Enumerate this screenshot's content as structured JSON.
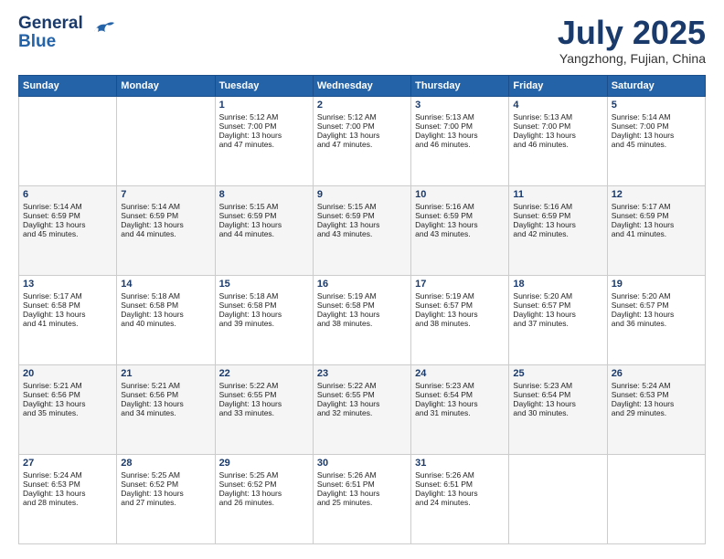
{
  "header": {
    "logo_line1": "General",
    "logo_line2": "Blue",
    "month": "July 2025",
    "location": "Yangzhong, Fujian, China"
  },
  "days_of_week": [
    "Sunday",
    "Monday",
    "Tuesday",
    "Wednesday",
    "Thursday",
    "Friday",
    "Saturday"
  ],
  "weeks": [
    [
      {
        "day": "",
        "info": ""
      },
      {
        "day": "",
        "info": ""
      },
      {
        "day": "1",
        "info": "Sunrise: 5:12 AM\nSunset: 7:00 PM\nDaylight: 13 hours\nand 47 minutes."
      },
      {
        "day": "2",
        "info": "Sunrise: 5:12 AM\nSunset: 7:00 PM\nDaylight: 13 hours\nand 47 minutes."
      },
      {
        "day": "3",
        "info": "Sunrise: 5:13 AM\nSunset: 7:00 PM\nDaylight: 13 hours\nand 46 minutes."
      },
      {
        "day": "4",
        "info": "Sunrise: 5:13 AM\nSunset: 7:00 PM\nDaylight: 13 hours\nand 46 minutes."
      },
      {
        "day": "5",
        "info": "Sunrise: 5:14 AM\nSunset: 7:00 PM\nDaylight: 13 hours\nand 45 minutes."
      }
    ],
    [
      {
        "day": "6",
        "info": "Sunrise: 5:14 AM\nSunset: 6:59 PM\nDaylight: 13 hours\nand 45 minutes."
      },
      {
        "day": "7",
        "info": "Sunrise: 5:14 AM\nSunset: 6:59 PM\nDaylight: 13 hours\nand 44 minutes."
      },
      {
        "day": "8",
        "info": "Sunrise: 5:15 AM\nSunset: 6:59 PM\nDaylight: 13 hours\nand 44 minutes."
      },
      {
        "day": "9",
        "info": "Sunrise: 5:15 AM\nSunset: 6:59 PM\nDaylight: 13 hours\nand 43 minutes."
      },
      {
        "day": "10",
        "info": "Sunrise: 5:16 AM\nSunset: 6:59 PM\nDaylight: 13 hours\nand 43 minutes."
      },
      {
        "day": "11",
        "info": "Sunrise: 5:16 AM\nSunset: 6:59 PM\nDaylight: 13 hours\nand 42 minutes."
      },
      {
        "day": "12",
        "info": "Sunrise: 5:17 AM\nSunset: 6:59 PM\nDaylight: 13 hours\nand 41 minutes."
      }
    ],
    [
      {
        "day": "13",
        "info": "Sunrise: 5:17 AM\nSunset: 6:58 PM\nDaylight: 13 hours\nand 41 minutes."
      },
      {
        "day": "14",
        "info": "Sunrise: 5:18 AM\nSunset: 6:58 PM\nDaylight: 13 hours\nand 40 minutes."
      },
      {
        "day": "15",
        "info": "Sunrise: 5:18 AM\nSunset: 6:58 PM\nDaylight: 13 hours\nand 39 minutes."
      },
      {
        "day": "16",
        "info": "Sunrise: 5:19 AM\nSunset: 6:58 PM\nDaylight: 13 hours\nand 38 minutes."
      },
      {
        "day": "17",
        "info": "Sunrise: 5:19 AM\nSunset: 6:57 PM\nDaylight: 13 hours\nand 38 minutes."
      },
      {
        "day": "18",
        "info": "Sunrise: 5:20 AM\nSunset: 6:57 PM\nDaylight: 13 hours\nand 37 minutes."
      },
      {
        "day": "19",
        "info": "Sunrise: 5:20 AM\nSunset: 6:57 PM\nDaylight: 13 hours\nand 36 minutes."
      }
    ],
    [
      {
        "day": "20",
        "info": "Sunrise: 5:21 AM\nSunset: 6:56 PM\nDaylight: 13 hours\nand 35 minutes."
      },
      {
        "day": "21",
        "info": "Sunrise: 5:21 AM\nSunset: 6:56 PM\nDaylight: 13 hours\nand 34 minutes."
      },
      {
        "day": "22",
        "info": "Sunrise: 5:22 AM\nSunset: 6:55 PM\nDaylight: 13 hours\nand 33 minutes."
      },
      {
        "day": "23",
        "info": "Sunrise: 5:22 AM\nSunset: 6:55 PM\nDaylight: 13 hours\nand 32 minutes."
      },
      {
        "day": "24",
        "info": "Sunrise: 5:23 AM\nSunset: 6:54 PM\nDaylight: 13 hours\nand 31 minutes."
      },
      {
        "day": "25",
        "info": "Sunrise: 5:23 AM\nSunset: 6:54 PM\nDaylight: 13 hours\nand 30 minutes."
      },
      {
        "day": "26",
        "info": "Sunrise: 5:24 AM\nSunset: 6:53 PM\nDaylight: 13 hours\nand 29 minutes."
      }
    ],
    [
      {
        "day": "27",
        "info": "Sunrise: 5:24 AM\nSunset: 6:53 PM\nDaylight: 13 hours\nand 28 minutes."
      },
      {
        "day": "28",
        "info": "Sunrise: 5:25 AM\nSunset: 6:52 PM\nDaylight: 13 hours\nand 27 minutes."
      },
      {
        "day": "29",
        "info": "Sunrise: 5:25 AM\nSunset: 6:52 PM\nDaylight: 13 hours\nand 26 minutes."
      },
      {
        "day": "30",
        "info": "Sunrise: 5:26 AM\nSunset: 6:51 PM\nDaylight: 13 hours\nand 25 minutes."
      },
      {
        "day": "31",
        "info": "Sunrise: 5:26 AM\nSunset: 6:51 PM\nDaylight: 13 hours\nand 24 minutes."
      },
      {
        "day": "",
        "info": ""
      },
      {
        "day": "",
        "info": ""
      }
    ]
  ]
}
